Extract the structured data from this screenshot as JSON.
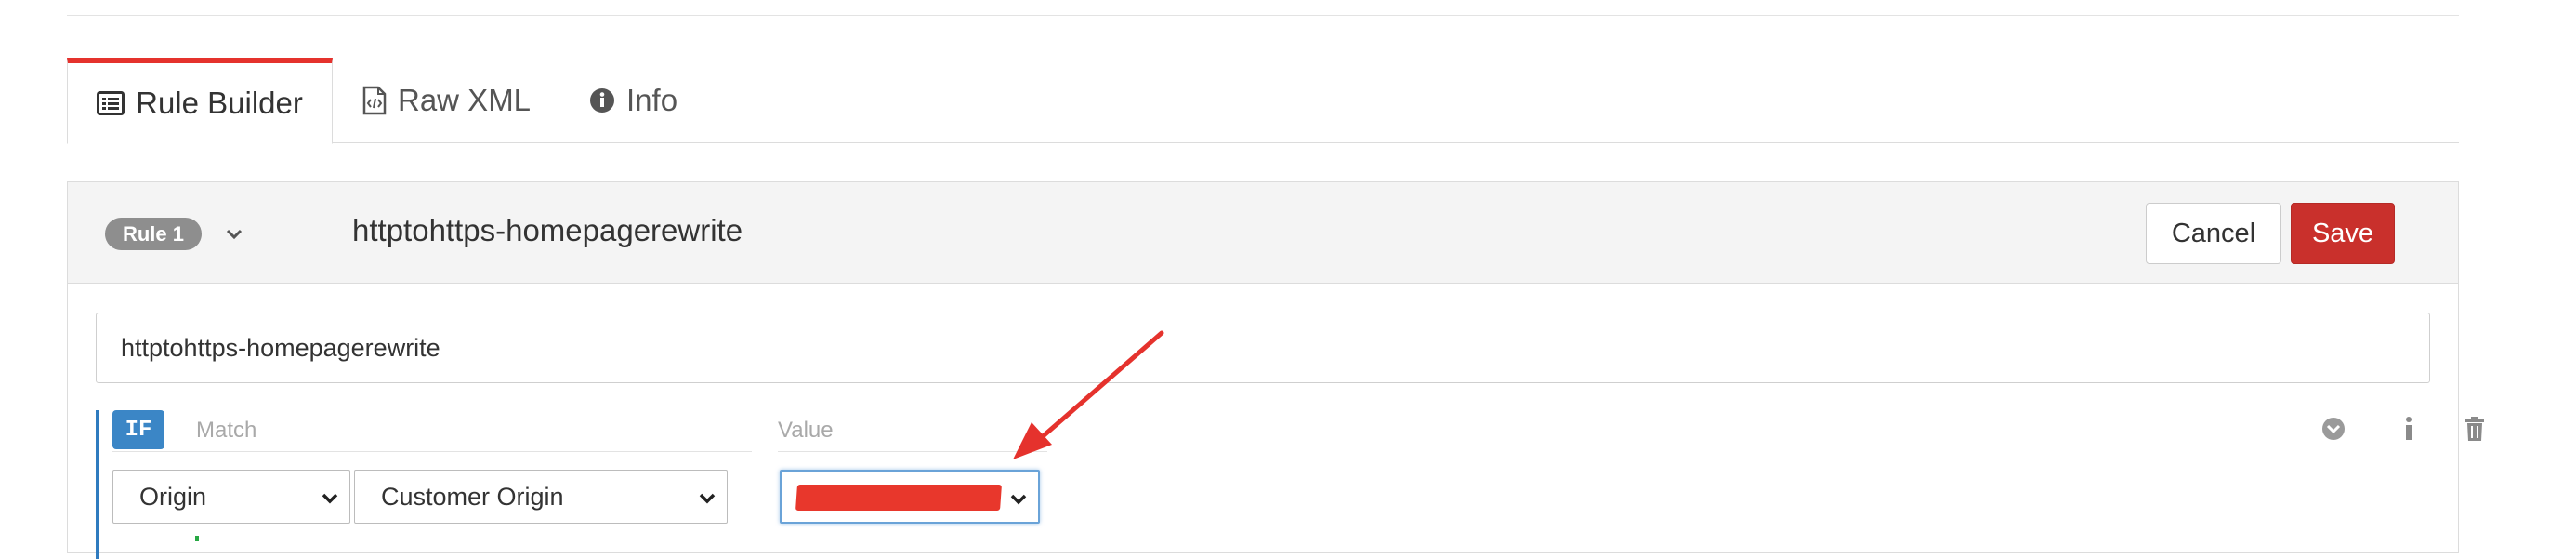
{
  "tabs": [
    {
      "label": "Rule Builder",
      "icon": "list-icon",
      "active": true
    },
    {
      "label": "Raw XML",
      "icon": "code-file-icon",
      "active": false
    },
    {
      "label": "Info",
      "icon": "info-circle-icon",
      "active": false
    }
  ],
  "rule": {
    "badge": "Rule 1",
    "name": "httptohttps-homepagerewrite",
    "name_input_value": "httptohttps-homepagerewrite"
  },
  "buttons": {
    "cancel": "Cancel",
    "save": "Save"
  },
  "condition": {
    "keyword": "IF",
    "match_label": "Match",
    "value_label": "Value",
    "match_type": "Origin",
    "match_value": "Customer Origin",
    "value": ""
  },
  "colors": {
    "accent_red": "#e5322d",
    "save_button": "#c9302c",
    "if_badge": "#3b86c6",
    "annotation_arrow": "#e5322d"
  }
}
